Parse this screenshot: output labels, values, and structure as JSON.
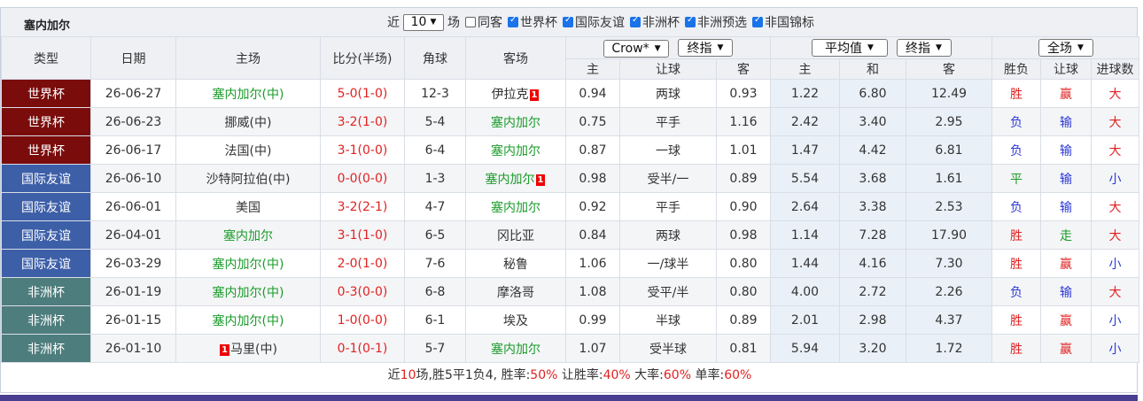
{
  "team_title": "塞内加尔",
  "filters": {
    "prefix": "近",
    "count": "10",
    "suffix": "场",
    "items": [
      {
        "label": "同客",
        "checked": false
      },
      {
        "label": "世界杯",
        "checked": true
      },
      {
        "label": "国际友谊",
        "checked": true
      },
      {
        "label": "非洲杯",
        "checked": true
      },
      {
        "label": "非洲预选",
        "checked": true
      },
      {
        "label": "非国锦标",
        "checked": true
      }
    ]
  },
  "headers": {
    "type": "类型",
    "date": "日期",
    "home": "主场",
    "score": "比分(半场)",
    "corners": "角球",
    "away": "客场",
    "asian_company": "Crow*",
    "asian_period": "终指",
    "euro_company": "平均值",
    "euro_period": "终指",
    "result_scope": "全场",
    "asian_home": "主",
    "asian_line": "让球",
    "asian_away": "客",
    "euro_home": "主",
    "euro_draw": "和",
    "euro_away": "客",
    "res_wl": "胜负",
    "res_handicap": "让球",
    "res_goals": "进球数"
  },
  "colors": {
    "world_cup": "#7b0c0c",
    "friendly": "#3d5fa8",
    "afcon": "#4e7d7d",
    "home_team": "#1a9b2a",
    "score": "#e02222",
    "win_red": "#e02222",
    "lose_blue": "#2b37d6"
  },
  "matches": [
    {
      "type": "世界杯",
      "tcolor": "#7b0c0c",
      "date": "26-06-27",
      "home": "塞内加尔(中)",
      "home_green": true,
      "home_card": "",
      "away": "伊拉克",
      "away_green": false,
      "away_card": "1",
      "score": "5-0(1-0)",
      "corners": "12-3",
      "ah": "0.94",
      "line": "两球",
      "aa": "0.93",
      "eh": "1.22",
      "ed": "6.80",
      "ea": "12.49",
      "wl": "胜",
      "wlc": "red",
      "hc": "赢",
      "hcc": "red",
      "goals": "大",
      "gc": "red"
    },
    {
      "type": "世界杯",
      "tcolor": "#7b0c0c",
      "date": "26-06-23",
      "home": "挪威(中)",
      "home_green": false,
      "home_card": "",
      "away": "塞内加尔",
      "away_green": true,
      "away_card": "",
      "score": "3-2(1-0)",
      "corners": "5-4",
      "ah": "0.75",
      "line": "平手",
      "aa": "1.16",
      "eh": "2.42",
      "ed": "3.40",
      "ea": "2.95",
      "wl": "负",
      "wlc": "blue",
      "hc": "输",
      "hcc": "blue",
      "goals": "大",
      "gc": "red"
    },
    {
      "type": "世界杯",
      "tcolor": "#7b0c0c",
      "date": "26-06-17",
      "home": "法国(中)",
      "home_green": false,
      "home_card": "",
      "away": "塞内加尔",
      "away_green": true,
      "away_card": "",
      "score": "3-1(0-0)",
      "corners": "6-4",
      "ah": "0.87",
      "line": "一球",
      "aa": "1.01",
      "eh": "1.47",
      "ed": "4.42",
      "ea": "6.81",
      "wl": "负",
      "wlc": "blue",
      "hc": "输",
      "hcc": "blue",
      "goals": "大",
      "gc": "red"
    },
    {
      "type": "国际友谊",
      "tcolor": "#3d5fa8",
      "date": "26-06-10",
      "home": "沙特阿拉伯(中)",
      "home_green": false,
      "home_card": "",
      "away": "塞内加尔",
      "away_green": true,
      "away_card": "1",
      "score": "0-0(0-0)",
      "corners": "1-3",
      "ah": "0.98",
      "line": "受半/一",
      "aa": "0.89",
      "eh": "5.54",
      "ed": "3.68",
      "ea": "1.61",
      "wl": "平",
      "wlc": "green",
      "hc": "输",
      "hcc": "blue",
      "goals": "小",
      "gc": "blue"
    },
    {
      "type": "国际友谊",
      "tcolor": "#3d5fa8",
      "date": "26-06-01",
      "home": "美国",
      "home_green": false,
      "home_card": "",
      "away": "塞内加尔",
      "away_green": true,
      "away_card": "",
      "score": "3-2(2-1)",
      "corners": "4-7",
      "ah": "0.92",
      "line": "平手",
      "aa": "0.90",
      "eh": "2.64",
      "ed": "3.38",
      "ea": "2.53",
      "wl": "负",
      "wlc": "blue",
      "hc": "输",
      "hcc": "blue",
      "goals": "大",
      "gc": "red"
    },
    {
      "type": "国际友谊",
      "tcolor": "#3d5fa8",
      "date": "26-04-01",
      "home": "塞内加尔",
      "home_green": true,
      "home_card": "",
      "away": "冈比亚",
      "away_green": false,
      "away_card": "",
      "score": "3-1(1-0)",
      "corners": "6-5",
      "ah": "0.84",
      "line": "两球",
      "aa": "0.98",
      "eh": "1.14",
      "ed": "7.28",
      "ea": "17.90",
      "wl": "胜",
      "wlc": "red",
      "hc": "走",
      "hcc": "green",
      "goals": "大",
      "gc": "red"
    },
    {
      "type": "国际友谊",
      "tcolor": "#3d5fa8",
      "date": "26-03-29",
      "home": "塞内加尔(中)",
      "home_green": true,
      "home_card": "",
      "away": "秘鲁",
      "away_green": false,
      "away_card": "",
      "score": "2-0(1-0)",
      "corners": "7-6",
      "ah": "1.06",
      "line": "一/球半",
      "aa": "0.80",
      "eh": "1.44",
      "ed": "4.16",
      "ea": "7.30",
      "wl": "胜",
      "wlc": "red",
      "hc": "赢",
      "hcc": "red",
      "goals": "小",
      "gc": "blue"
    },
    {
      "type": "非洲杯",
      "tcolor": "#4e7d7d",
      "date": "26-01-19",
      "home": "塞内加尔(中)",
      "home_green": true,
      "home_card": "",
      "away": "摩洛哥",
      "away_green": false,
      "away_card": "",
      "score": "0-3(0-0)",
      "corners": "6-8",
      "ah": "1.08",
      "line": "受平/半",
      "aa": "0.80",
      "eh": "4.00",
      "ed": "2.72",
      "ea": "2.26",
      "wl": "负",
      "wlc": "blue",
      "hc": "输",
      "hcc": "blue",
      "goals": "大",
      "gc": "red"
    },
    {
      "type": "非洲杯",
      "tcolor": "#4e7d7d",
      "date": "26-01-15",
      "home": "塞内加尔(中)",
      "home_green": true,
      "home_card": "",
      "away": "埃及",
      "away_green": false,
      "away_card": "",
      "score": "1-0(0-0)",
      "corners": "6-1",
      "ah": "0.99",
      "line": "半球",
      "aa": "0.89",
      "eh": "2.01",
      "ed": "2.98",
      "ea": "4.37",
      "wl": "胜",
      "wlc": "red",
      "hc": "赢",
      "hcc": "red",
      "goals": "小",
      "gc": "blue"
    },
    {
      "type": "非洲杯",
      "tcolor": "#4e7d7d",
      "date": "26-01-10",
      "home": "马里(中)",
      "home_green": false,
      "home_card": "1",
      "away": "塞内加尔",
      "away_green": true,
      "away_card": "",
      "score": "0-1(0-1)",
      "corners": "5-7",
      "ah": "1.07",
      "line": "受半球",
      "aa": "0.81",
      "eh": "5.94",
      "ed": "3.20",
      "ea": "1.72",
      "wl": "胜",
      "wlc": "red",
      "hc": "赢",
      "hcc": "red",
      "goals": "小",
      "gc": "blue"
    }
  ],
  "summary": {
    "p1": "近",
    "games": "10",
    "p2": "场,胜5平1负4, 胜率:",
    "win_rate": "50%",
    "p3": " 让胜率:",
    "hc_rate": "40%",
    "p4": " 大率:",
    "big_rate": "60%",
    "p5": " 单率:",
    "odd_rate": "60%"
  }
}
